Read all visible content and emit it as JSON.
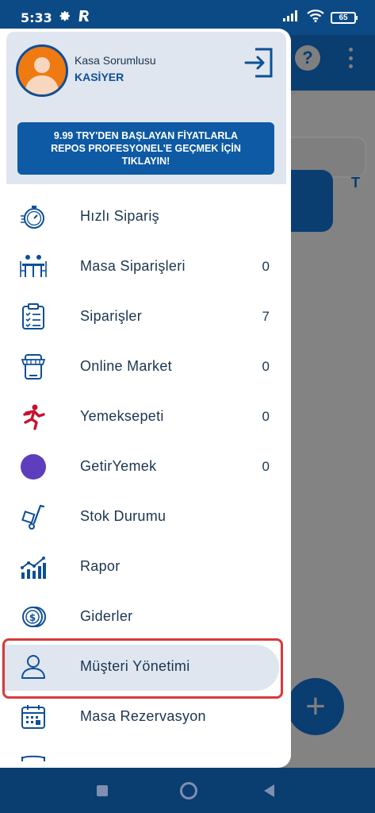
{
  "status_bar": {
    "time": "5:33",
    "battery": "65"
  },
  "drawer": {
    "header": {
      "role_label": "Kasa Sorumlusu",
      "user_name": "KASİYER",
      "promo_text": "9.99 TRY'DEN BAŞLAYAN FİYATLARLA\nREPOS PROFESYONEL'E GEÇMEK İÇİN\nTIKLAYIN!"
    },
    "menu": [
      {
        "label": "Hızlı Sipariş",
        "count": "",
        "icon": "stopwatch-icon"
      },
      {
        "label": "Masa Siparişleri",
        "count": "0",
        "icon": "dining-table-icon"
      },
      {
        "label": "Siparişler",
        "count": "7",
        "icon": "clipboard-list-icon"
      },
      {
        "label": "Online Market",
        "count": "0",
        "icon": "storefront-icon"
      },
      {
        "label": "Yemeksepeti",
        "count": "0",
        "icon": "yemeksepeti-logo-icon"
      },
      {
        "label": "GetirYemek",
        "count": "0",
        "icon": "getir-logo-icon"
      },
      {
        "label": "Stok Durumu",
        "count": "",
        "icon": "hand-truck-icon"
      },
      {
        "label": "Rapor",
        "count": "",
        "icon": "bar-chart-icon"
      },
      {
        "label": "Giderler",
        "count": "",
        "icon": "coins-icon"
      },
      {
        "label": "Müşteri Yönetimi",
        "count": "",
        "icon": "user-icon",
        "selected": true
      },
      {
        "label": "Masa Rezervasyon",
        "count": "",
        "icon": "calendar-icon"
      }
    ]
  },
  "background_app": {
    "partial_letter": "T"
  },
  "colors": {
    "primary": "#0e5aa4",
    "dark": "#0a3d70",
    "header_bg": "#dfe6ef",
    "text": "#1b3550",
    "highlight": "#d93a3a"
  }
}
